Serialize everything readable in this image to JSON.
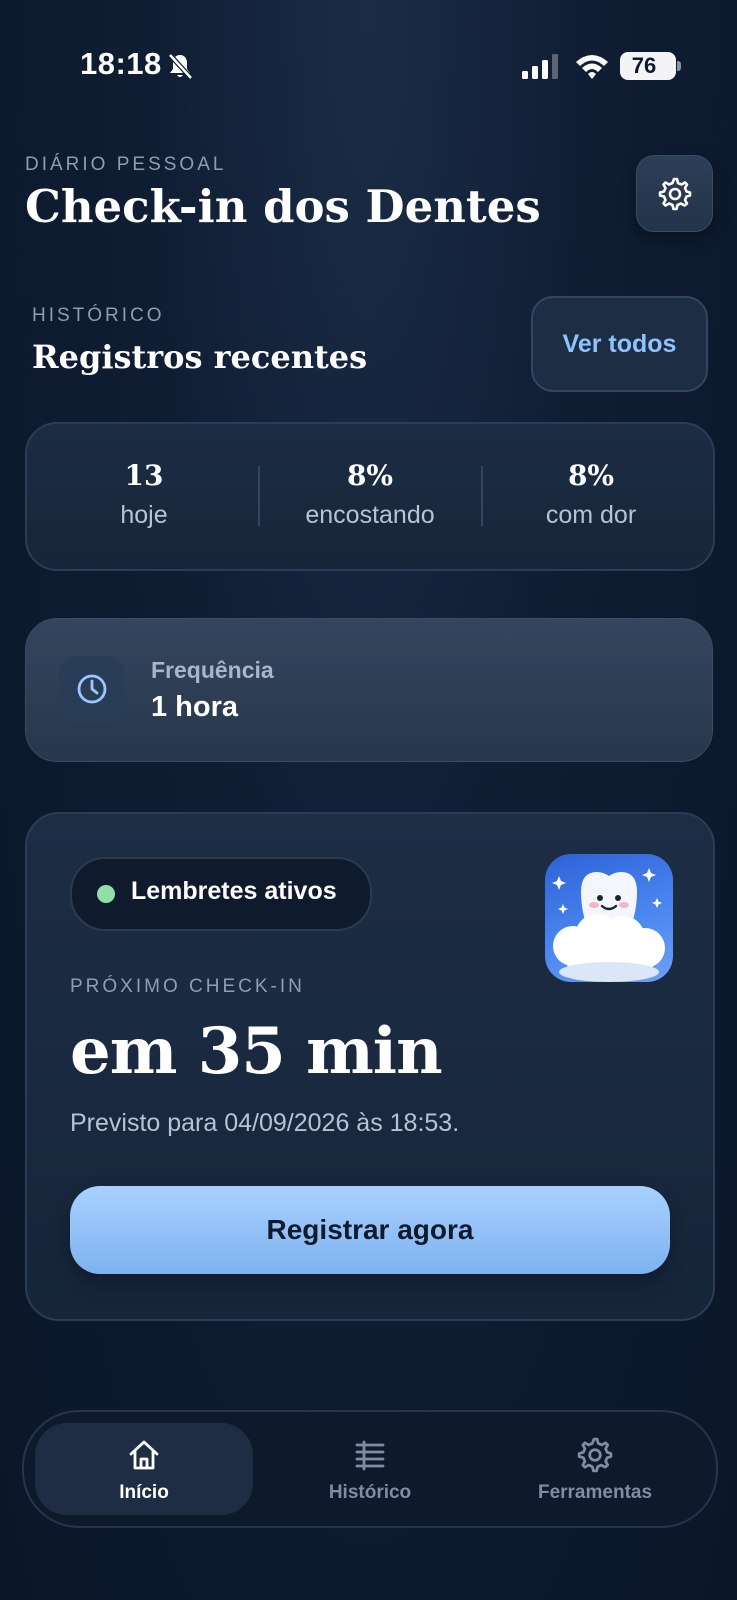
{
  "status_bar": {
    "time": "18:18",
    "battery": "76",
    "icons": [
      "bell-slash-icon",
      "cellular-signal-icon",
      "wifi-icon",
      "battery-icon"
    ]
  },
  "header": {
    "eyebrow": "DIÁRIO PESSOAL",
    "title": "Check-in dos Dentes",
    "settings_icon": "gear-icon"
  },
  "history_section": {
    "eyebrow": "HISTÓRICO",
    "title": "Registros recentes",
    "view_all_label": "Ver todos"
  },
  "stats": [
    {
      "value": "13",
      "label": "hoje"
    },
    {
      "value": "8%",
      "label": "encostando"
    },
    {
      "value": "8%",
      "label": "com dor"
    }
  ],
  "frequency": {
    "label": "Frequência",
    "value": "1 hora",
    "icon": "clock-icon"
  },
  "next_checkin": {
    "reminder_status": "Lembretes ativos",
    "reminder_dot_color": "#8ee0a5",
    "eyebrow": "PRÓXIMO CHECK-IN",
    "time_until": "em 35 min",
    "forecast": "Previsto para 04/09/2026 às 18:53.",
    "register_label": "Registrar agora",
    "mascot": "smiling-tooth-on-cloud-image"
  },
  "tabs": [
    {
      "label": "Início",
      "icon": "home-icon",
      "active": true
    },
    {
      "label": "Histórico",
      "icon": "list-icon",
      "active": false
    },
    {
      "label": "Ferramentas",
      "icon": "gear-icon",
      "active": false
    }
  ],
  "colors": {
    "background": "#0f1d33",
    "accent": "#8ec3ff",
    "button": "#a9d1ff",
    "active_tab_text": "#ffffff",
    "inactive_tab_text": "#7f8ca1"
  }
}
